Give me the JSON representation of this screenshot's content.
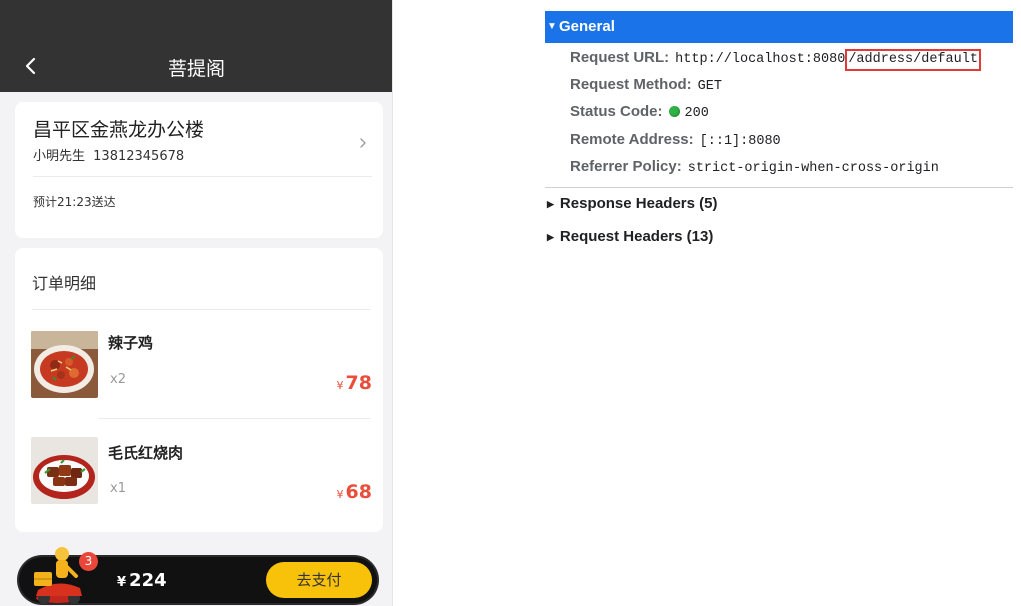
{
  "mobile": {
    "header": {
      "title": "菩提阁",
      "back_icon": "back-chevron-icon"
    },
    "address": {
      "title": "昌平区金燕龙办公楼",
      "contact_name": "小明先生",
      "phone": "13812345678",
      "eta": "预计21:23送达"
    },
    "order": {
      "heading": "订单明细",
      "items": [
        {
          "name": "辣子鸡",
          "qty": "x2",
          "currency": "¥",
          "price": "78"
        },
        {
          "name": "毛氏红烧肉",
          "qty": "x1",
          "currency": "¥",
          "price": "68"
        }
      ]
    },
    "cart": {
      "badge_count": "3",
      "currency": "¥",
      "total": "224",
      "pay_label": "去支付"
    }
  },
  "devtools": {
    "general_label": "General",
    "request_url_label": "Request URL:",
    "request_url_prefix": "http://localhost:8080",
    "request_url_path": "/address/default",
    "request_method_label": "Request Method:",
    "request_method": "GET",
    "status_code_label": "Status Code:",
    "status_code": "200",
    "remote_address_label": "Remote Address:",
    "remote_address": "[::1]:8080",
    "referrer_policy_label": "Referrer Policy:",
    "referrer_policy": "strict-origin-when-cross-origin",
    "response_headers_label": "Response Headers (5)",
    "request_headers_label": "Request Headers (13)",
    "colors": {
      "general_bg": "#1a73e8",
      "status_ok": "#2fb344",
      "highlight_box": "#e53935"
    }
  }
}
